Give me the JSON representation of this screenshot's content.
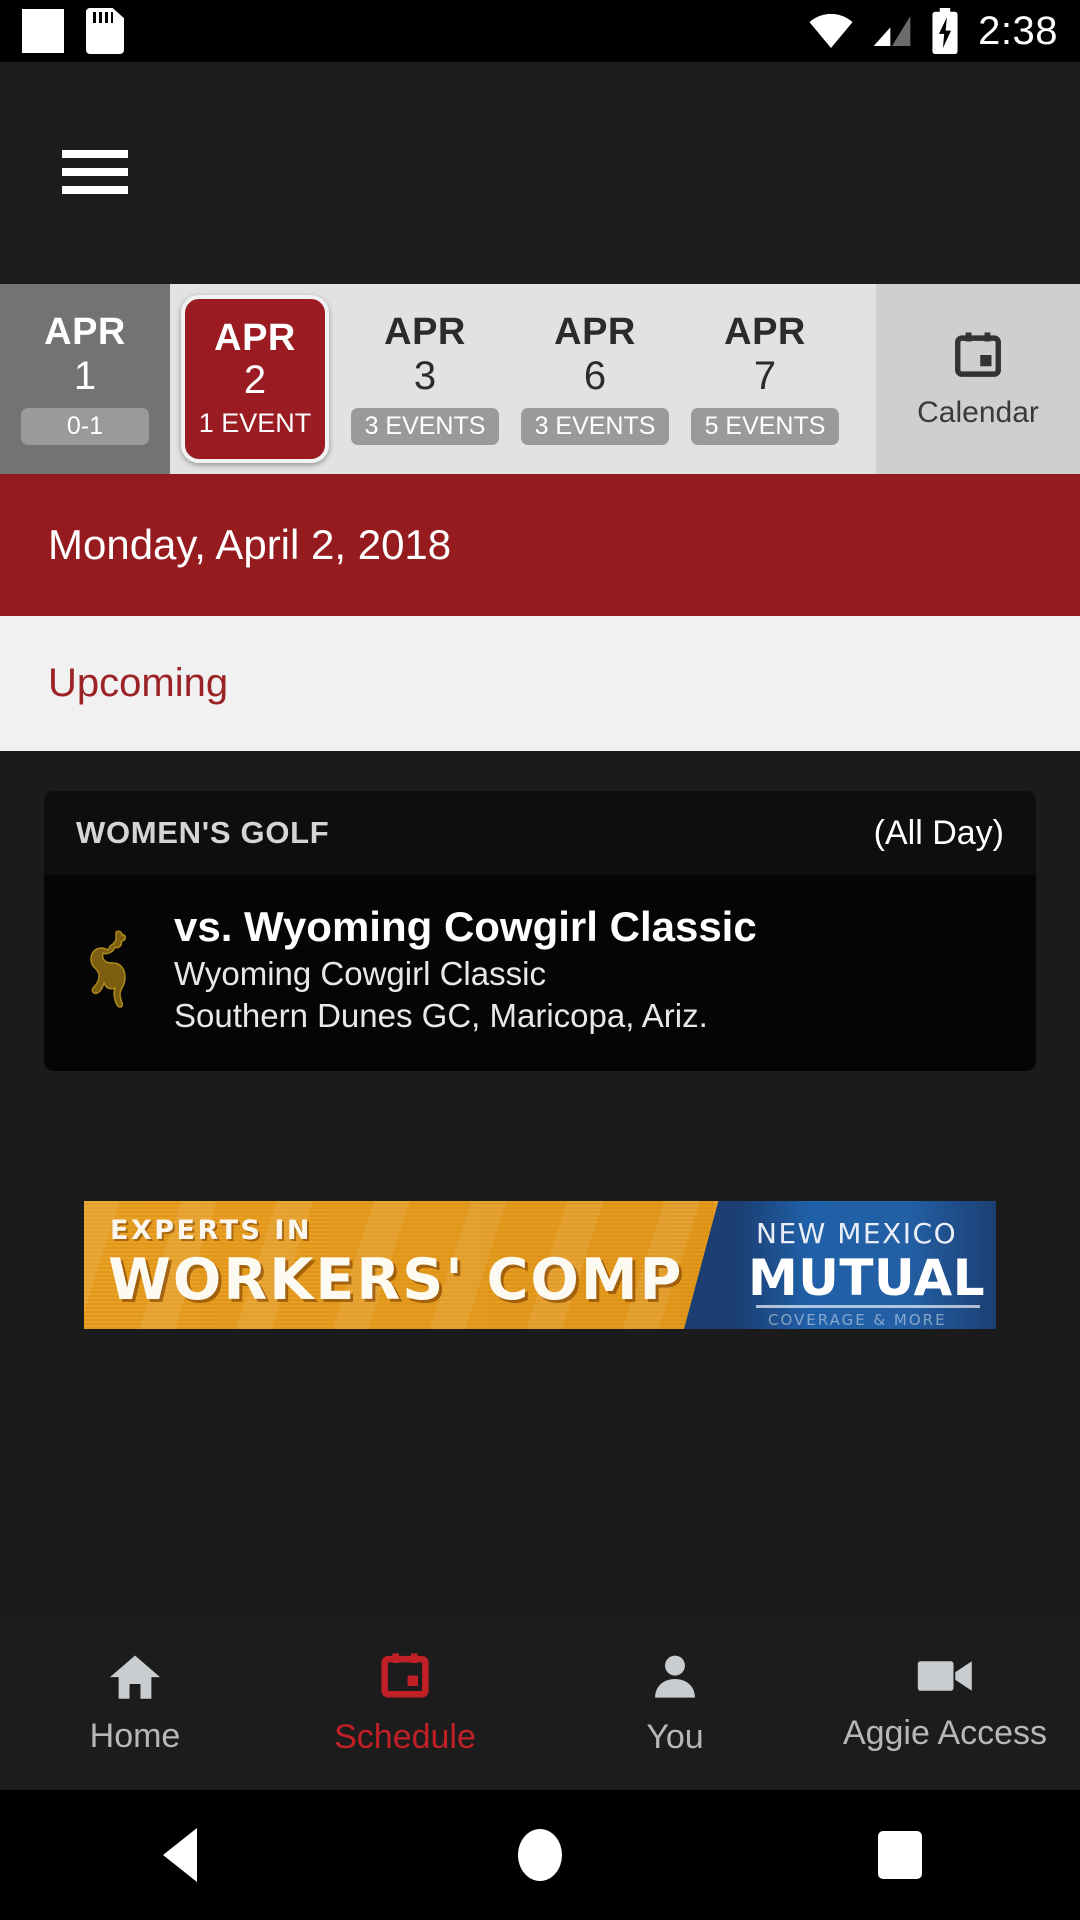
{
  "status_bar": {
    "time": "2:38",
    "icons": [
      "blank-notification-icon",
      "sd-card-icon",
      "wifi-icon",
      "cell-signal-icon",
      "battery-charging-icon"
    ]
  },
  "app_bar": {
    "menu_icon": "hamburger-menu-icon"
  },
  "date_strip": {
    "days": [
      {
        "month": "APR",
        "day": "1",
        "badge": "0-1",
        "state": "past"
      },
      {
        "month": "APR",
        "day": "2",
        "badge": "1 EVENT",
        "state": "selected"
      },
      {
        "month": "APR",
        "day": "3",
        "badge": "3 EVENTS",
        "state": "normal"
      },
      {
        "month": "APR",
        "day": "6",
        "badge": "3 EVENTS",
        "state": "normal"
      },
      {
        "month": "APR",
        "day": "7",
        "badge": "5 EVENTS",
        "state": "normal"
      }
    ],
    "calendar_button": {
      "label": "Calendar",
      "icon": "calendar-icon"
    }
  },
  "date_header": {
    "text": "Monday, April 2, 2018"
  },
  "section": {
    "title": "Upcoming"
  },
  "event_card": {
    "sport": "WOMEN'S GOLF",
    "time": "(All Day)",
    "opponent_logo": "wyoming-bucking-horse-logo",
    "title": "vs. Wyoming Cowgirl Classic",
    "subtitle_1": "Wyoming Cowgirl Classic",
    "subtitle_2": "Southern Dunes GC, Maricopa, Ariz."
  },
  "advertisement": {
    "line_1": "EXPERTS IN",
    "line_2": "WORKERS' COMP",
    "brand_line_1": "NEW MEXICO",
    "brand_line_2": "MUTUAL",
    "brand_tagline": "COVERAGE & MORE"
  },
  "bottom_tabs": [
    {
      "label": "Home",
      "icon": "home-icon",
      "active": false
    },
    {
      "label": "Schedule",
      "icon": "calendar-icon",
      "active": true
    },
    {
      "label": "You",
      "icon": "person-icon",
      "active": false
    },
    {
      "label": "Aggie Access",
      "icon": "video-camera-icon",
      "active": false
    }
  ],
  "android_nav": {
    "back": "back-triangle-icon",
    "home": "home-circle-icon",
    "recents": "recents-square-icon"
  },
  "colors": {
    "brand_red": "#951b1f",
    "selected_red": "#9b1b22",
    "accent_red": "#c02026",
    "ad_orange": "#e8a020",
    "ad_blue": "#1b3f73",
    "logo_gold": "#7a5c10"
  }
}
